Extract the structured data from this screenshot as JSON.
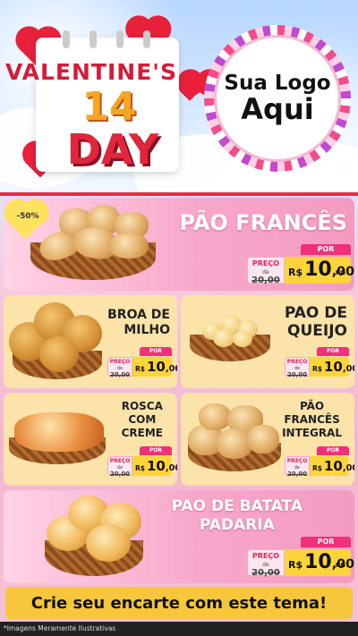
{
  "header": {
    "title_line1": "VALENTINE'S",
    "title_number": "14",
    "title_line2": "DAY",
    "logo_line1": "Sua Logo",
    "logo_line2": "Aqui"
  },
  "products": [
    {
      "name_line1": "PÃO FRANCÊS",
      "name_line2": "",
      "price_label": "PREÇO",
      "old_prefix": "de",
      "old_price": "20,00",
      "por_label": "POR",
      "currency": "R$",
      "price_int": "10",
      "price_dec": ",00",
      "unit": "KG",
      "discount": "-50%"
    },
    {
      "name_line1": "BROA DE",
      "name_line2": "MILHO",
      "price_label": "PREÇO",
      "old_prefix": "de",
      "old_price": "20,00",
      "por_label": "POR",
      "currency": "R$",
      "price_int": "10",
      "price_dec": ",00",
      "unit": ""
    },
    {
      "name_line1": "PAO DE",
      "name_line2": "QUEIJO",
      "price_label": "PREÇO",
      "old_prefix": "de",
      "old_price": "20,00",
      "por_label": "POR",
      "currency": "R$",
      "price_int": "10",
      "price_dec": ",00",
      "unit": ""
    },
    {
      "name_line1": "ROSCA",
      "name_line2": "COM",
      "name_line3": "CREME",
      "price_label": "PREÇO",
      "old_prefix": "de",
      "old_price": "20,00",
      "por_label": "POR",
      "currency": "R$",
      "price_int": "10",
      "price_dec": ",00",
      "unit": ""
    },
    {
      "name_line1": "PÃO",
      "name_line2": "FRANCÊS",
      "name_line3": "INTEGRAL",
      "price_label": "PREÇO",
      "old_prefix": "de",
      "old_price": "20,00",
      "por_label": "POR",
      "currency": "R$",
      "price_int": "10",
      "price_dec": ",00",
      "unit": ""
    },
    {
      "name_line1": "PAO DE BATATA",
      "name_line2": "PADARIA",
      "price_label": "PREÇO",
      "old_prefix": "de",
      "old_price": "20,00",
      "por_label": "POR",
      "currency": "R$",
      "price_int": "10",
      "price_dec": ",00",
      "unit": "KG"
    }
  ],
  "cta": {
    "text": "Crie seu encarte com este tema!"
  },
  "footer": {
    "disclaimer": "*Imagens Meramente Ilustrativas"
  },
  "colors": {
    "accent_red": "#ec2a43",
    "price_yellow": "#ffd43b",
    "tag_pink": "#f0307a"
  }
}
